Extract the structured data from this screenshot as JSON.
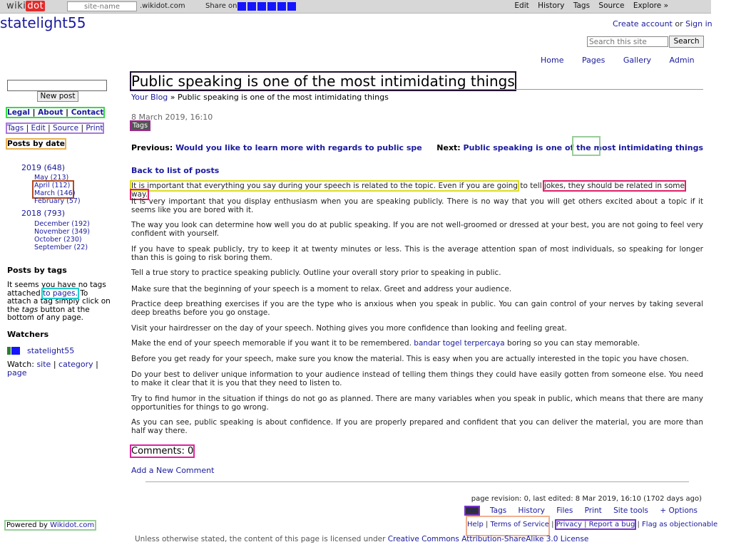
{
  "topbar": {
    "logo_wiki": "wiki",
    "logo_dot": "dot",
    "site_name_placeholder": "site-name",
    "domain_suffix": ".wikidot.com",
    "share_label": "Share on",
    "share_icon_count": 6,
    "menu": [
      "Edit",
      "History",
      "Tags",
      "Source",
      "Explore »"
    ]
  },
  "header": {
    "site_title": "statelight55",
    "create_account": "Create account",
    "or": "or",
    "sign_in": "Sign in",
    "search_placeholder": "Search this site",
    "search_button": "Search",
    "nav": [
      "Home",
      "Pages",
      "Gallery",
      "Admin"
    ]
  },
  "sidebar": {
    "new_post": "New post",
    "legal_row": {
      "a": "Legal",
      "b": "About",
      "c": "Contact"
    },
    "tags_row": {
      "a": "Tags",
      "b": "Edit",
      "c": "Source",
      "d": "Print"
    },
    "posts_by_date": "Posts by date",
    "year_2019": "2019 (648)",
    "months_2019": [
      "May (213)",
      "April (112)",
      "March (146)",
      "February (57)"
    ],
    "year_2018": "2018 (793)",
    "months_2018": [
      "December (192)",
      "November (349)",
      "October (230)",
      "September (22)"
    ],
    "posts_by_tags": "Posts by tags",
    "no_tags_1": "It seems you have no tags attached ",
    "no_tags_link": "to pages.",
    "no_tags_2": " To attach a tag simply click on the ",
    "no_tags_tags": "tags",
    "no_tags_3": " button at the bottom of any page.",
    "watchers": "Watchers",
    "watcher_name": "statelight55",
    "watch_label": "Watch:",
    "watch_site": "site",
    "watch_category": "category",
    "watch_page": "page",
    "powered_by": "Powered by",
    "powered_by_link": "Wikidot.com"
  },
  "post": {
    "title": "Public speaking is one of the most intimidating things",
    "breadcrumb_link": "Your Blog",
    "breadcrumb_sep": " » ",
    "breadcrumb_current": "Public speaking is one of the most intimidating things",
    "date": "8 March 2019, 16:10",
    "tags_label": "Tags",
    "previous_label": "Previous:",
    "previous_link": "Would you like to learn more with regards to public spe",
    "next_label": "Next:",
    "next_link": "Public speaking is one of the most intimidating things",
    "back_to_list": "Back to list of posts",
    "p1_a": "It is important that everything you say during your speech is related to the topic. Even if you are going",
    "p1_b": " to tell ",
    "p1_c": "jokes, they should be related in some way.",
    "p2": "It is very important that you display enthusiasm when you are speaking publicly. There is no way that you will get others excited about a topic if it seems like you are bored with it.",
    "p3": "The way you look can determine how well you do at public speaking. If you are not well-groomed or dressed at your best, you are not going to feel very confident with yourself.",
    "p4": "If you have to speak publicly, try to keep it at twenty minutes or less. This is the average attention span of most individuals, so speaking for longer than this is going to risk boring them.",
    "p5": "Tell a true story to practice speaking publicly. Outline your overall story prior to speaking in public.",
    "p6": "Make sure that the beginning of your speech is a moment to relax. Greet and address your audience.",
    "p7": "Practice deep breathing exercises if you are the type who is anxious when you speak in public. You can gain control of your nerves by taking several deep breaths before you go onstage.",
    "p8": "Visit your hairdresser on the day of your speech. Nothing gives you more confidence than looking and feeling great.",
    "p9_a": "Make the end of your speech memorable if you want it to be remembered. ",
    "p9_link": "bandar togel terpercaya",
    "p9_b": " boring so you can stay memorable.",
    "p10": "Before you get ready for your speech, make sure you know the material. This is easy when you are actually interested in the topic you have chosen.",
    "p11": "Do your best to deliver unique information to your audience instead of telling them things they could have easily gotten from someone else. You need to make it clear that it is you that they need to listen to.",
    "p12": "Try to find humor in the situation if things do not go as planned. There are many variables when you speak in public, which means that there are many opportunities for things to go wrong.",
    "p13": "As you can see, public speaking is about confidence. If you are properly prepared and confident that you can deliver the material, you are more than half way there.",
    "comments_heading": "Comments: 0",
    "add_comment": "Add a New Comment"
  },
  "footer": {
    "page_revision": "page revision: 0, last edited: 8 Mar 2019, 16:10 (1702 days ago)",
    "edit_badge": "Edit",
    "options": [
      "Tags",
      "History",
      "Files",
      "Print",
      "Site tools",
      "+ Options"
    ],
    "help": "Help",
    "terms": "Terms of Service",
    "privacy": "Privacy",
    "report_bug": "Report a bug",
    "flag": "Flag as objectionable",
    "license_prefix": "Unless otherwise stated, the content of this page is licensed under ",
    "license_link": "Creative Commons Attribution-ShareAlike 3.0 License"
  }
}
